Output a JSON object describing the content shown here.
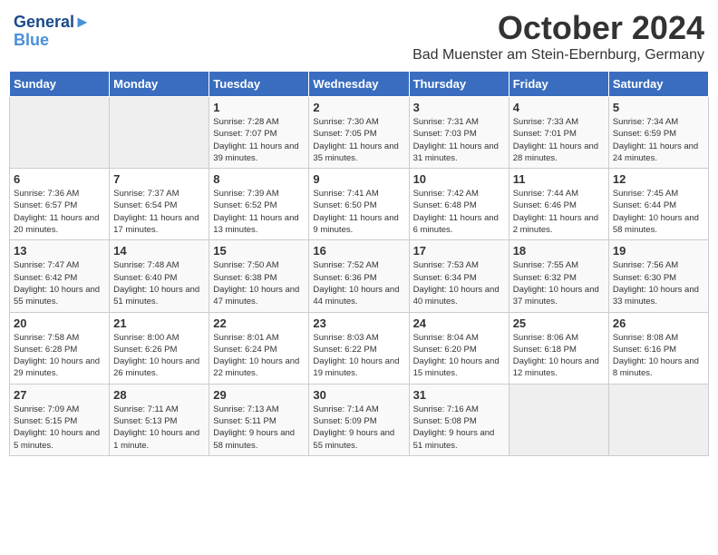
{
  "header": {
    "logo_line1": "General",
    "logo_line2": "Blue",
    "month_title": "October 2024",
    "location": "Bad Muenster am Stein-Ebernburg, Germany"
  },
  "days_of_week": [
    "Sunday",
    "Monday",
    "Tuesday",
    "Wednesday",
    "Thursday",
    "Friday",
    "Saturday"
  ],
  "weeks": [
    [
      {
        "day": "",
        "detail": ""
      },
      {
        "day": "",
        "detail": ""
      },
      {
        "day": "1",
        "detail": "Sunrise: 7:28 AM\nSunset: 7:07 PM\nDaylight: 11 hours and 39 minutes."
      },
      {
        "day": "2",
        "detail": "Sunrise: 7:30 AM\nSunset: 7:05 PM\nDaylight: 11 hours and 35 minutes."
      },
      {
        "day": "3",
        "detail": "Sunrise: 7:31 AM\nSunset: 7:03 PM\nDaylight: 11 hours and 31 minutes."
      },
      {
        "day": "4",
        "detail": "Sunrise: 7:33 AM\nSunset: 7:01 PM\nDaylight: 11 hours and 28 minutes."
      },
      {
        "day": "5",
        "detail": "Sunrise: 7:34 AM\nSunset: 6:59 PM\nDaylight: 11 hours and 24 minutes."
      }
    ],
    [
      {
        "day": "6",
        "detail": "Sunrise: 7:36 AM\nSunset: 6:57 PM\nDaylight: 11 hours and 20 minutes."
      },
      {
        "day": "7",
        "detail": "Sunrise: 7:37 AM\nSunset: 6:54 PM\nDaylight: 11 hours and 17 minutes."
      },
      {
        "day": "8",
        "detail": "Sunrise: 7:39 AM\nSunset: 6:52 PM\nDaylight: 11 hours and 13 minutes."
      },
      {
        "day": "9",
        "detail": "Sunrise: 7:41 AM\nSunset: 6:50 PM\nDaylight: 11 hours and 9 minutes."
      },
      {
        "day": "10",
        "detail": "Sunrise: 7:42 AM\nSunset: 6:48 PM\nDaylight: 11 hours and 6 minutes."
      },
      {
        "day": "11",
        "detail": "Sunrise: 7:44 AM\nSunset: 6:46 PM\nDaylight: 11 hours and 2 minutes."
      },
      {
        "day": "12",
        "detail": "Sunrise: 7:45 AM\nSunset: 6:44 PM\nDaylight: 10 hours and 58 minutes."
      }
    ],
    [
      {
        "day": "13",
        "detail": "Sunrise: 7:47 AM\nSunset: 6:42 PM\nDaylight: 10 hours and 55 minutes."
      },
      {
        "day": "14",
        "detail": "Sunrise: 7:48 AM\nSunset: 6:40 PM\nDaylight: 10 hours and 51 minutes."
      },
      {
        "day": "15",
        "detail": "Sunrise: 7:50 AM\nSunset: 6:38 PM\nDaylight: 10 hours and 47 minutes."
      },
      {
        "day": "16",
        "detail": "Sunrise: 7:52 AM\nSunset: 6:36 PM\nDaylight: 10 hours and 44 minutes."
      },
      {
        "day": "17",
        "detail": "Sunrise: 7:53 AM\nSunset: 6:34 PM\nDaylight: 10 hours and 40 minutes."
      },
      {
        "day": "18",
        "detail": "Sunrise: 7:55 AM\nSunset: 6:32 PM\nDaylight: 10 hours and 37 minutes."
      },
      {
        "day": "19",
        "detail": "Sunrise: 7:56 AM\nSunset: 6:30 PM\nDaylight: 10 hours and 33 minutes."
      }
    ],
    [
      {
        "day": "20",
        "detail": "Sunrise: 7:58 AM\nSunset: 6:28 PM\nDaylight: 10 hours and 29 minutes."
      },
      {
        "day": "21",
        "detail": "Sunrise: 8:00 AM\nSunset: 6:26 PM\nDaylight: 10 hours and 26 minutes."
      },
      {
        "day": "22",
        "detail": "Sunrise: 8:01 AM\nSunset: 6:24 PM\nDaylight: 10 hours and 22 minutes."
      },
      {
        "day": "23",
        "detail": "Sunrise: 8:03 AM\nSunset: 6:22 PM\nDaylight: 10 hours and 19 minutes."
      },
      {
        "day": "24",
        "detail": "Sunrise: 8:04 AM\nSunset: 6:20 PM\nDaylight: 10 hours and 15 minutes."
      },
      {
        "day": "25",
        "detail": "Sunrise: 8:06 AM\nSunset: 6:18 PM\nDaylight: 10 hours and 12 minutes."
      },
      {
        "day": "26",
        "detail": "Sunrise: 8:08 AM\nSunset: 6:16 PM\nDaylight: 10 hours and 8 minutes."
      }
    ],
    [
      {
        "day": "27",
        "detail": "Sunrise: 7:09 AM\nSunset: 5:15 PM\nDaylight: 10 hours and 5 minutes."
      },
      {
        "day": "28",
        "detail": "Sunrise: 7:11 AM\nSunset: 5:13 PM\nDaylight: 10 hours and 1 minute."
      },
      {
        "day": "29",
        "detail": "Sunrise: 7:13 AM\nSunset: 5:11 PM\nDaylight: 9 hours and 58 minutes."
      },
      {
        "day": "30",
        "detail": "Sunrise: 7:14 AM\nSunset: 5:09 PM\nDaylight: 9 hours and 55 minutes."
      },
      {
        "day": "31",
        "detail": "Sunrise: 7:16 AM\nSunset: 5:08 PM\nDaylight: 9 hours and 51 minutes."
      },
      {
        "day": "",
        "detail": ""
      },
      {
        "day": "",
        "detail": ""
      }
    ]
  ]
}
